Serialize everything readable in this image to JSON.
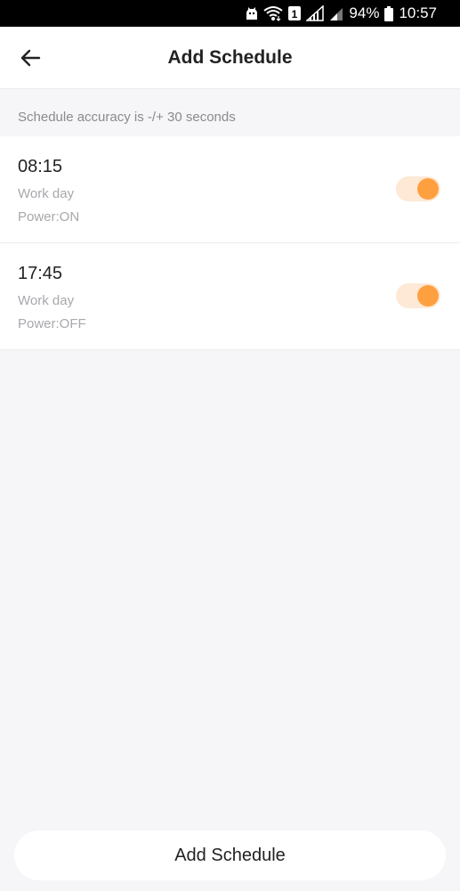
{
  "status_bar": {
    "battery_percent": "94%",
    "time": "10:57",
    "sim_slot": "1"
  },
  "header": {
    "title": "Add Schedule",
    "back_icon": "arrow-left-icon"
  },
  "accuracy_note": "Schedule accuracy is -/+ 30 seconds",
  "schedules": [
    {
      "time": "08:15",
      "days": "Work day",
      "power": "Power:ON",
      "enabled": true
    },
    {
      "time": "17:45",
      "days": "Work day",
      "power": "Power:OFF",
      "enabled": true
    }
  ],
  "add_button_label": "Add Schedule",
  "colors": {
    "accent": "#ffa040",
    "toggle_track": "#fde9d6",
    "background": "#f6f5f8"
  }
}
